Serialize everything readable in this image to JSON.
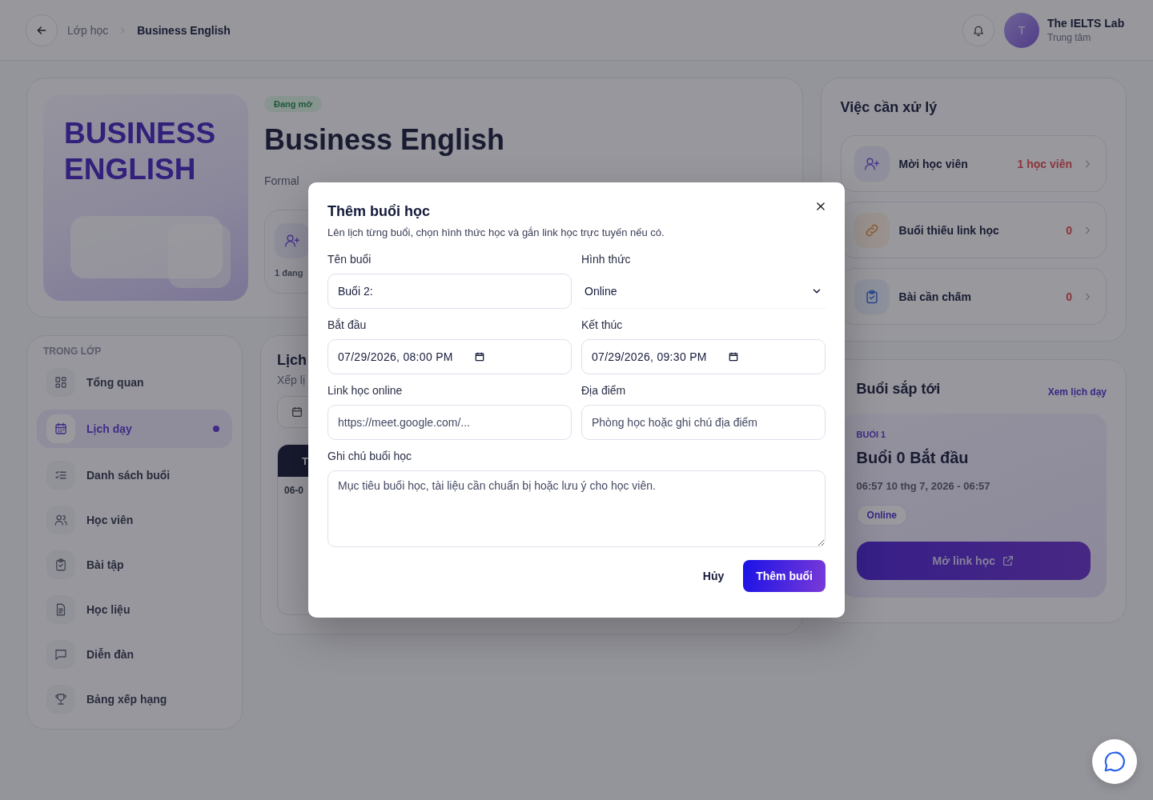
{
  "header": {
    "breadcrumb": [
      {
        "label": "Lớp học",
        "current": false
      },
      {
        "label": "Business English",
        "current": true
      }
    ],
    "user": {
      "initial": "T",
      "name": "The IELTS Lab",
      "role": "Trung tâm"
    }
  },
  "course": {
    "cover_title": "BUSINESS ENGLISH",
    "status": "Đang mở",
    "title": "Business English",
    "subtitle": "Formal",
    "stat": "1 đang"
  },
  "sidebar": {
    "heading": "TRONG LỚP",
    "items": [
      {
        "label": "Tổng quan",
        "kind": "grid",
        "selected": false
      },
      {
        "label": "Lịch dạy",
        "kind": "calendar",
        "selected": true
      },
      {
        "label": "Danh sách buổi",
        "kind": "checklist",
        "selected": false
      },
      {
        "label": "Học viên",
        "kind": "users",
        "selected": false
      },
      {
        "label": "Bài tập",
        "kind": "clipboard",
        "selected": false
      },
      {
        "label": "Học liệu",
        "kind": "file",
        "selected": false
      },
      {
        "label": "Diễn đàn",
        "kind": "chat",
        "selected": false
      },
      {
        "label": "Bảng xếp hạng",
        "kind": "trophy",
        "selected": false
      }
    ]
  },
  "schedule": {
    "title": "Lịch",
    "subtitle": "Xếp lị",
    "table_header": "T",
    "first_cell": "06-0"
  },
  "tasks": {
    "title": "Việc cần xử lý",
    "items": [
      {
        "label": "Mời học viên",
        "count": "1 học viên",
        "kind": "invite"
      },
      {
        "label": "Buổi thiếu link học",
        "count": "0",
        "kind": "link"
      },
      {
        "label": "Bài cần chấm",
        "count": "0",
        "kind": "grading"
      }
    ]
  },
  "upcoming": {
    "title": "Buổi sắp tới",
    "link": "Xem lịch dạy",
    "session_label": "BUỔI 1",
    "session_title": "Buổi 0 Bắt đầu",
    "time": "06:57 10 thg 7, 2026 - 06:57",
    "mode": "Online",
    "button": "Mở link học"
  },
  "modal": {
    "title": "Thêm buổi học",
    "description": "Lên lịch từng buổi, chọn hình thức học và gắn link học trực tuyến nếu có.",
    "fields": [
      {
        "label": "Tên buổi",
        "kind": "text",
        "value": "Buổi 2:"
      },
      {
        "label": "Hình thức",
        "kind": "select",
        "value": "Online"
      },
      {
        "label": "Bắt đầu",
        "kind": "datetime",
        "value": "07/29/2026, 08:00 PM"
      },
      {
        "label": "Kết thúc",
        "kind": "datetime",
        "value": "07/29/2026, 09:30 PM"
      },
      {
        "label": "Link học online",
        "kind": "text",
        "placeholder": "https://meet.google.com/..."
      },
      {
        "label": "Địa điểm",
        "kind": "text",
        "placeholder": "Phòng học hoặc ghi chú địa điểm"
      },
      {
        "label": "Ghi chú buổi học",
        "kind": "textarea",
        "placeholder": "Mục tiêu buổi học, tài liệu cần chuẩn bị hoặc lưu ý cho học viên."
      }
    ],
    "cancel": "Hủy",
    "submit": "Thêm buổi"
  }
}
